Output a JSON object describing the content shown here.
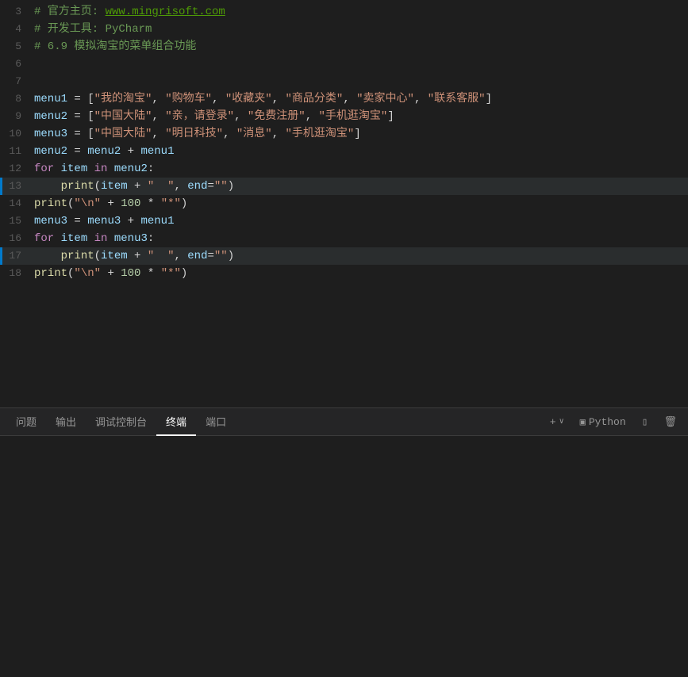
{
  "editor": {
    "lines": [
      {
        "num": 3,
        "content": "comment_url",
        "type": "comment_url"
      },
      {
        "num": 4,
        "content": "comment_pycharm",
        "type": "comment"
      },
      {
        "num": 5,
        "content": "comment_title",
        "type": "comment"
      },
      {
        "num": 6,
        "content": "",
        "type": "empty"
      },
      {
        "num": 7,
        "content": "",
        "type": "empty"
      },
      {
        "num": 8,
        "content": "menu1_def",
        "type": "code"
      },
      {
        "num": 9,
        "content": "menu2_def",
        "type": "code"
      },
      {
        "num": 10,
        "content": "menu3_def",
        "type": "code"
      },
      {
        "num": 11,
        "content": "menu2_assign",
        "type": "code"
      },
      {
        "num": 12,
        "content": "for_menu2",
        "type": "code"
      },
      {
        "num": 13,
        "content": "print_item",
        "type": "code"
      },
      {
        "num": 14,
        "content": "print_nl1",
        "type": "code"
      },
      {
        "num": 15,
        "content": "menu3_assign",
        "type": "code"
      },
      {
        "num": 16,
        "content": "for_menu3",
        "type": "code"
      },
      {
        "num": 17,
        "content": "print_item2",
        "type": "code"
      },
      {
        "num": 18,
        "content": "print_nl2",
        "type": "code"
      }
    ]
  },
  "bottom_panel": {
    "tabs": [
      "问题",
      "输出",
      "调试控制台",
      "终端",
      "端口"
    ],
    "active_tab": "终端",
    "actions": {
      "add": "+",
      "chevron": "∨",
      "terminal_icon": "⊡",
      "terminal_label": "Python",
      "split_icon": "⊟",
      "trash_icon": "🗑"
    }
  }
}
